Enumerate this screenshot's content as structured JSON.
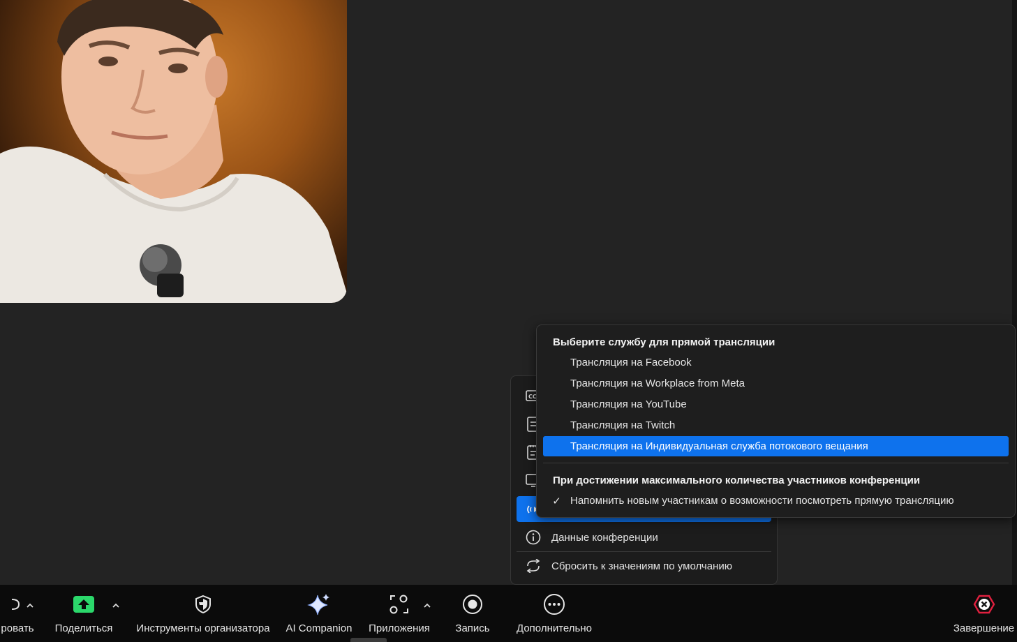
{
  "toolbar": {
    "partial_label": "ровать",
    "share_label": "Поделиться",
    "host_tools_label": "Инструменты организатора",
    "ai_companion_label": "AI Companion",
    "apps_label": "Приложения",
    "record_label": "Запись",
    "more_label": "Дополнительно",
    "end_label": "Завершение"
  },
  "more_menu": {
    "cc_icon_text": "CC",
    "meeting_info_label": "Данные конференции",
    "reset_defaults_label": "Сбросить к значениям по умолчанию"
  },
  "live_stream_menu": {
    "header": "Выберите службу для прямой трансляции",
    "services": [
      "Трансляция на Facebook",
      "Трансляция на Workplace from Meta",
      "Трансляция на YouTube",
      "Трансляция на Twitch",
      "Трансляция на Индивидуальная служба потокового вещания"
    ],
    "selected_service_index": 4,
    "max_participants_header": "При достижении максимального количества участников конференции",
    "reminder_option": "Напомнить новым участникам о возможности посмотреть прямую трансляцию",
    "reminder_checked": true,
    "check_mark": "✓"
  },
  "colors": {
    "accent": "#0e72ed",
    "share_green": "#2bd86b",
    "end_red": "#e0203f",
    "background": "#232323"
  },
  "icons": {
    "share": "share-arrow-up-icon",
    "host_tools": "shield-icon",
    "ai_companion": "sparkle-icon",
    "apps": "apps-grid-icon",
    "record": "record-icon",
    "more": "ellipsis-icon",
    "end": "end-x-icon"
  }
}
